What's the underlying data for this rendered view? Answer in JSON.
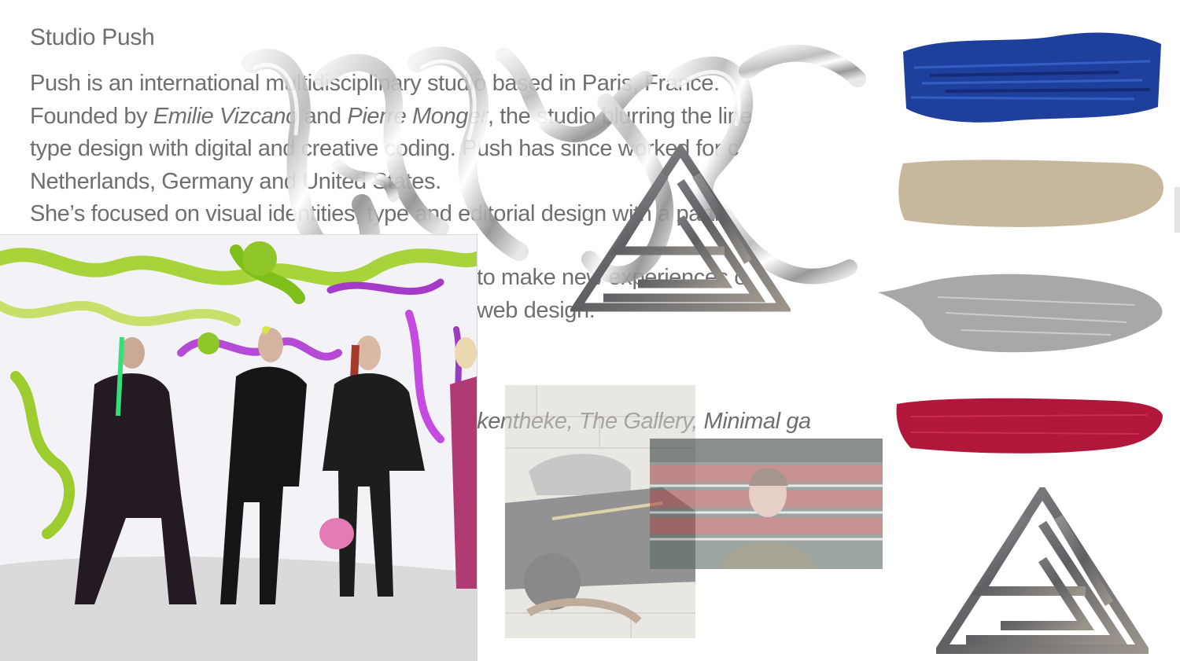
{
  "studio": {
    "title": "Studio Push",
    "line1": "Push is an international multidisciplinary studio based in Paris, France.",
    "line2_pre": "Founded by ",
    "founder1": "Emilie Vizcano",
    "line2_mid": " and ",
    "founder2": "Pierre Monger",
    "line2_post": ", the studio blurring the line",
    "line3": "type design with digital and creative coding. Push has since worked for c",
    "line4": "Netherlands, Germany and United States.",
    "line5": "She’s focused on visual identities, type and editorial design with a partic",
    "line6": "to make new experiences o",
    "line7": "web design.",
    "clients": "kkentheke, The Gallery, Minimal ga"
  },
  "images": {
    "chrome_letters": "chrome-3d-lettering",
    "triangle_logo": "impossible-triangle-logo",
    "fashion_photo": "fashion-group-photo",
    "scooter_photo": "scooter-photo",
    "film_still": "film-still-photo"
  },
  "swatches": {
    "blue": "#1f3f9c",
    "beige": "#c7b89d",
    "silver": "#a8a8a8",
    "red": "#b0173a"
  }
}
